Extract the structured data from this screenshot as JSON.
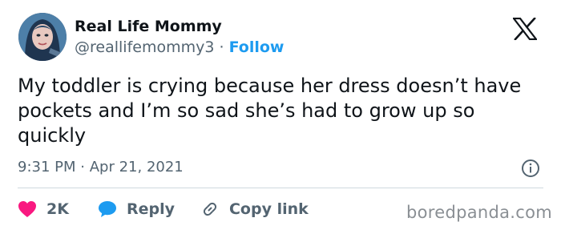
{
  "author": {
    "display_name": "Real Life Mommy",
    "handle": "@reallifemommy3",
    "separator": "·",
    "follow_label": "Follow"
  },
  "tweet": {
    "text": "My toddler is crying because her dress doesn’t have pockets and I’m so sad she’s had to grow up so quickly",
    "time": "9:31 PM",
    "date_separator": "·",
    "date": "Apr 21, 2021"
  },
  "actions": {
    "like_count": "2K",
    "reply_label": "Reply",
    "copy_link_label": "Copy link"
  },
  "watermark": "boredpanda.com",
  "icons": {
    "logo": "x-logo-icon",
    "info": "info-icon",
    "like": "heart-icon",
    "reply": "speech-bubble-icon",
    "copy_link": "link-icon"
  },
  "colors": {
    "text": "#0f1419",
    "secondary": "#536471",
    "accent": "#1d9bf0",
    "like": "#f91880",
    "divider": "#cfd9de",
    "watermark": "#8a8f94"
  }
}
